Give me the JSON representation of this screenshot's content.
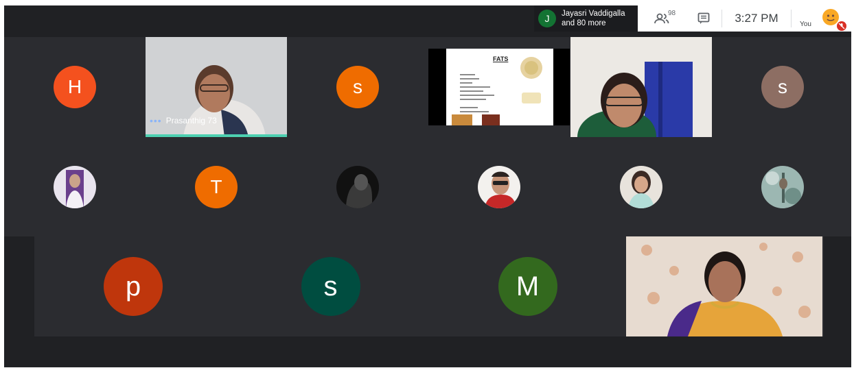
{
  "presenter_chip": {
    "initial": "J",
    "name": "Jayasri Vaddigalla",
    "more": "and 80 more"
  },
  "toolbar": {
    "participants_count": "98",
    "time": "3:27 PM",
    "you_label": "You"
  },
  "row1": [
    {
      "type": "avatar",
      "letter": "H",
      "color": "#f4511e"
    },
    {
      "type": "video",
      "name": "Prasanthig 73"
    },
    {
      "type": "avatar",
      "letter": "s",
      "color": "#ef6c00"
    },
    {
      "type": "slide",
      "title": "FATS"
    },
    {
      "type": "video"
    },
    {
      "type": "avatar",
      "letter": "s",
      "color": "#8d6e63"
    }
  ],
  "row2": [
    {
      "type": "photo-avatar"
    },
    {
      "type": "avatar",
      "letter": "T",
      "color": "#ef6c00"
    },
    {
      "type": "photo-avatar"
    },
    {
      "type": "photo-avatar"
    },
    {
      "type": "photo-avatar"
    },
    {
      "type": "photo-avatar"
    }
  ],
  "row3": [
    {
      "type": "avatar",
      "letter": "p",
      "color": "#bf360c"
    },
    {
      "type": "avatar",
      "letter": "s",
      "color": "#004d40"
    },
    {
      "type": "avatar",
      "letter": "M",
      "color": "#33691e"
    },
    {
      "type": "video"
    }
  ]
}
